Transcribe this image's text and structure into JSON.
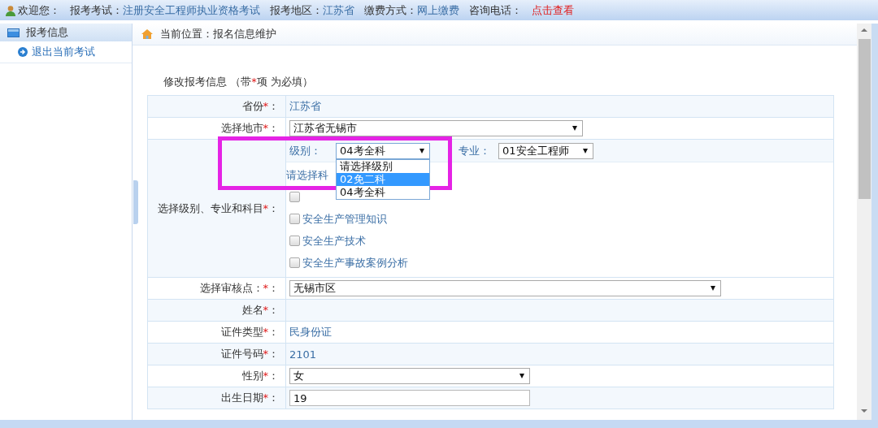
{
  "top_bar": {
    "greeting": "欢迎您：",
    "fields": [
      {
        "label": "报考考试：",
        "value": "注册安全工程师执业资格考试"
      },
      {
        "label": "报考地区：",
        "value": "江苏省"
      },
      {
        "label": "缴费方式：",
        "value": "网上缴费"
      }
    ],
    "contact": {
      "label": "咨询电话：",
      "link": "点击查看"
    }
  },
  "sidebar": {
    "section": "报考信息",
    "items": [
      {
        "label": "退出当前考试"
      }
    ]
  },
  "breadcrumb": "当前位置：报名信息维护",
  "form": {
    "title": {
      "before": "修改报考信息 （带",
      "mark": "*",
      "after": "项 为必填）"
    },
    "rows": [
      {
        "kind": "text",
        "label": "省份",
        "mark": "*",
        "colon": "：",
        "value": "江苏省"
      },
      {
        "kind": "select",
        "label": "选择地市",
        "mark": "*",
        "colon": "：",
        "value": "江苏省无锡市"
      },
      {
        "kind": "subjects",
        "label": "选择级别、专业和科目",
        "mark": "*",
        "colon": "：",
        "level_label": "级别：",
        "level_value": "04考全科",
        "level_options": [
          {
            "label": "请选择级别",
            "selected": false
          },
          {
            "label": "02免二科",
            "selected": true
          },
          {
            "label": "04考全科",
            "selected": false
          }
        ],
        "major_label": "专业：",
        "major_value": "01安全工程师",
        "hint": "请选择科",
        "subjects": [
          {
            "checked": false
          },
          {
            "label": "安全生产管理知识",
            "checked": false
          },
          {
            "label": "安全生产技术",
            "checked": false
          },
          {
            "label": "安全生产事故案例分析",
            "checked": false
          }
        ]
      },
      {
        "kind": "select",
        "label": "选择审核点：",
        "mark": "*",
        "colon": "：",
        "value": "无锡市区"
      },
      {
        "kind": "text",
        "label": "姓名",
        "mark": "*",
        "colon": "："
      },
      {
        "kind": "text",
        "label": "证件类型",
        "mark": "*",
        "colon": "：",
        "value": "民身份证"
      },
      {
        "kind": "text",
        "label": "证件号码",
        "mark": "*",
        "colon": "：",
        "value": "2101"
      },
      {
        "kind": "select",
        "label": "性别",
        "mark": "*",
        "colon": "：",
        "value": "女"
      },
      {
        "kind": "input",
        "label": "出生日期",
        "mark": "*",
        "colon": "：",
        "value": "19"
      }
    ]
  }
}
